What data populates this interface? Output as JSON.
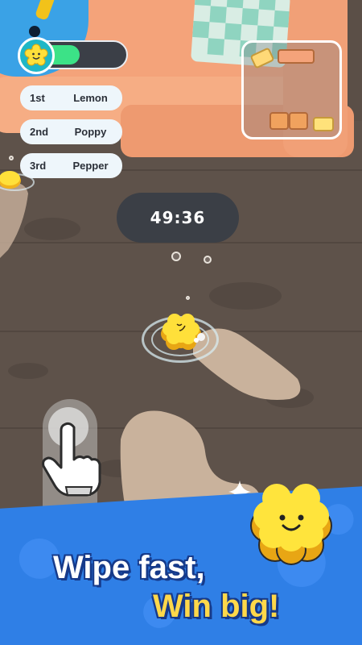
{
  "hud": {
    "timer": "49:36",
    "progress": 0.2,
    "avatar_icon": "sponge-face-icon"
  },
  "leaderboard": [
    {
      "rank": "1st",
      "name": "Lemon"
    },
    {
      "rank": "2nd",
      "name": "Poppy"
    },
    {
      "rank": "3rd",
      "name": "Pepper"
    }
  ],
  "banner": {
    "line1": "Wipe fast,",
    "line2": "Win big!"
  },
  "colors": {
    "accent_green": "#3ce287",
    "banner_blue": "#2f7fe6",
    "sponge_yellow": "#ffe03a",
    "title_yellow": "#ffd84a"
  }
}
